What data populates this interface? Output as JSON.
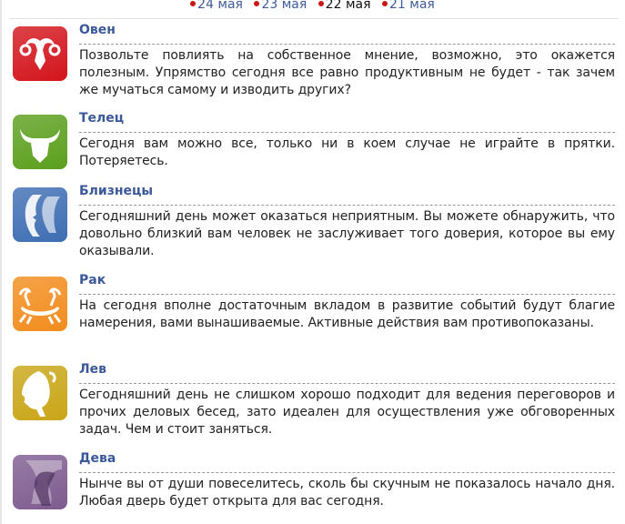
{
  "date_nav": [
    {
      "label": "24 мая",
      "current": false
    },
    {
      "label": "23 мая",
      "current": false
    },
    {
      "label": "22 мая",
      "current": true
    },
    {
      "label": "21 мая",
      "current": false
    }
  ],
  "signs": [
    {
      "name": "Овен",
      "icon": "aries-ram-icon",
      "color": "#d3141c",
      "text": "Позвольте повлиять на собственное мнение, возможно, это окажется полезным. Упрямство сегодня все равно продуктивным не будет - так зачем же мучаться самому и изводить других?"
    },
    {
      "name": "Телец",
      "icon": "taurus-bull-icon",
      "color": "#5b9f1c",
      "text": "Сегодня вам можно все, только ни в коем случае не играйте в прятки. Потеряетесь."
    },
    {
      "name": "Близнецы",
      "icon": "gemini-twins-icon",
      "color": "#3d6db2",
      "text": "Сегодняшний день может оказаться неприятным. Вы можете обнаружить, что довольно близкий вам человек не заслуживает того доверия, которое вы ему оказывали."
    },
    {
      "name": "Рак",
      "icon": "cancer-crab-icon",
      "color": "#f28c1c",
      "text": "На сегодня вполне достаточным вкладом в развитие событий будут благие намерения, вами вынашиваемые. Активные действия вам противопоказаны."
    },
    {
      "name": "Лев",
      "icon": "leo-lion-icon",
      "color": "#c9a516",
      "text": "Сегодняшний день не слишком хорошо подходит для ведения переговоров и прочих деловых бесед, зато идеален для осуществления уже обговоренных задач. Чем и стоит заняться."
    },
    {
      "name": "Дева",
      "icon": "virgo-maiden-icon",
      "color": "#7e5b8f",
      "text": "Нынче вы от души повеселитесь, сколь бы скучным не показалось начало дня. Любая дверь будет открыта для вас сегодня."
    }
  ]
}
